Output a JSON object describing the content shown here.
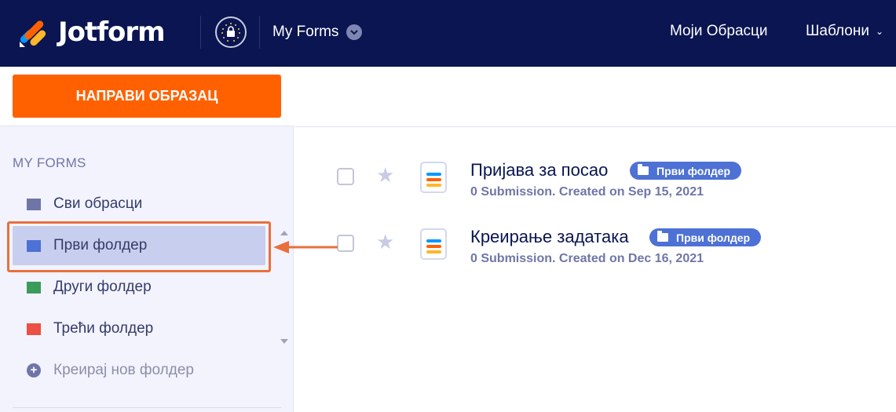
{
  "header": {
    "logo_text": "Jotform",
    "my_forms_label": "My Forms",
    "nav_links": [
      "Моји Обрасци",
      "Шаблони"
    ],
    "colors": {
      "background": "#0a1551",
      "text": "#ffffff"
    }
  },
  "sidebar": {
    "create_button_label": "НАПРАВИ ОБРАЗАЦ",
    "section_title": "MY FORMS",
    "folders": [
      {
        "label": "Сви обрасци",
        "color": "#6f76a7",
        "selected": false
      },
      {
        "label": "Први фолдер",
        "color": "#4d71d4",
        "selected": true
      },
      {
        "label": "Други фолдер",
        "color": "#3b9b5a",
        "selected": false
      },
      {
        "label": "Трећи фолдер",
        "color": "#ec4f43",
        "selected": false
      }
    ],
    "add_folder_label": "Креирај нов фолдер",
    "colors": {
      "create_button": "#ff6100",
      "highlight": "#e8703c"
    }
  },
  "forms": [
    {
      "title": "Пријава за посао",
      "meta": "0 Submission. Created on Sep 15, 2021",
      "folder_tag": "Први фолдер"
    },
    {
      "title": "Креирање задатака",
      "meta": "0 Submission. Created on Dec 16, 2021",
      "folder_tag": "Први фолдер"
    }
  ]
}
